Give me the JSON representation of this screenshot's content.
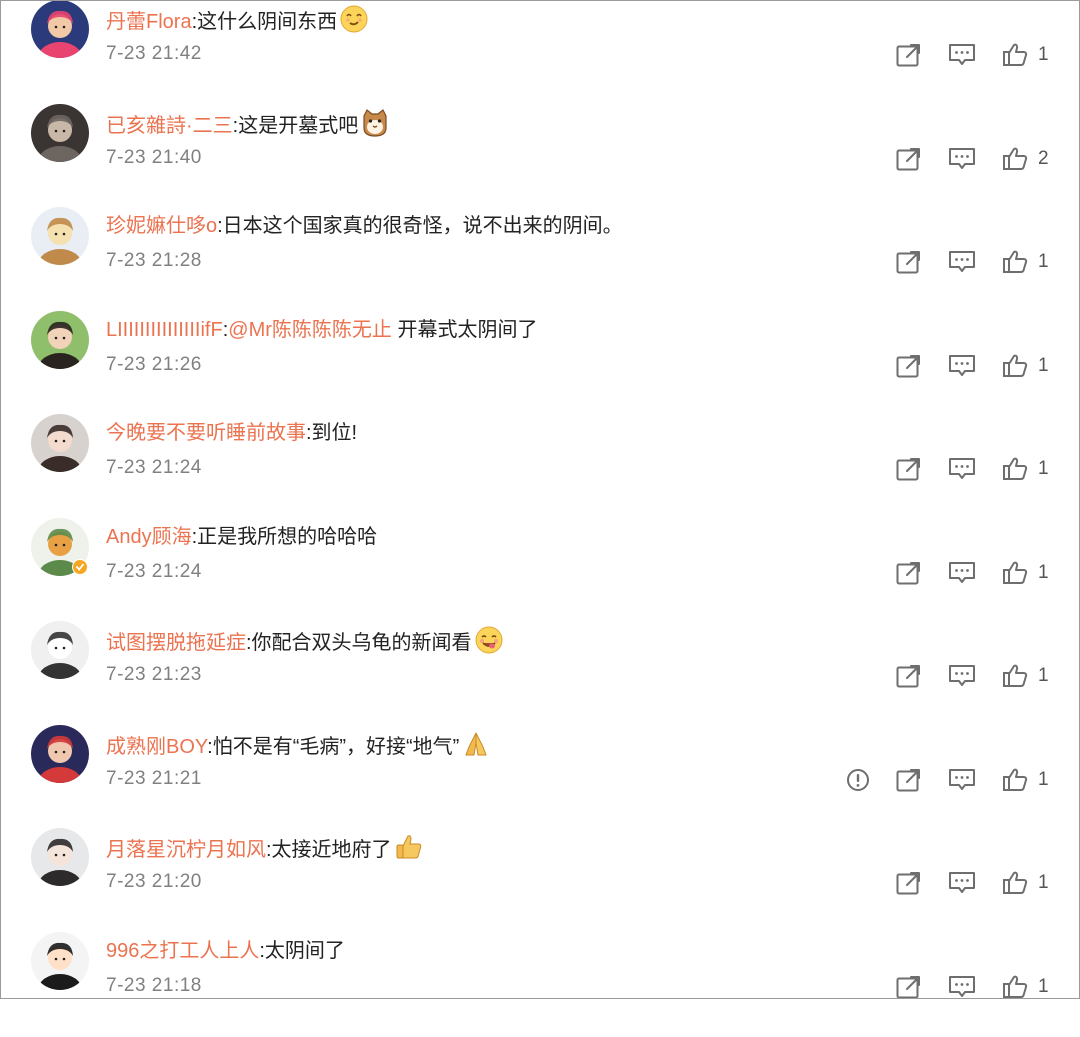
{
  "comments": [
    {
      "username": "丹蕾Flora",
      "text_parts": [
        {
          "t": ":这什么阴间东西",
          "mention": false
        }
      ],
      "emoji": "smirk-emoji-icon",
      "time": "7-23 21:42",
      "likes": "1",
      "report": false,
      "verified": false,
      "avatar": {
        "bg": "#2b3a7a",
        "fg": "#f2c9a6",
        "accent": "#e8446f"
      }
    },
    {
      "username": "已亥雜詩·二三",
      "text_parts": [
        {
          "t": ":这是开墓式吧",
          "mention": false
        }
      ],
      "emoji": "cat-emoji-icon",
      "time": "7-23 21:40",
      "likes": "2",
      "report": false,
      "verified": false,
      "avatar": {
        "bg": "#3a3432",
        "fg": "#c9b8a8",
        "accent": "#6d6560"
      }
    },
    {
      "username": "珍妮嫲仕哆o",
      "text_parts": [
        {
          "t": ":日本这个国家真的很奇怪，说不出来的阴间。",
          "mention": false
        }
      ],
      "emoji": "",
      "time": "7-23 21:28",
      "likes": "1",
      "report": false,
      "verified": false,
      "avatar": {
        "bg": "#e9eef5",
        "fg": "#f5e0b0",
        "accent": "#c08a4a"
      }
    },
    {
      "username": "LIIIIIIIIIIIIIIIifF",
      "text_parts": [
        {
          "t": ":",
          "mention": false
        },
        {
          "t": "@Mr陈陈陈陈无止",
          "mention": true
        },
        {
          "t": " 开幕式太阴间了",
          "mention": false
        }
      ],
      "emoji": "",
      "time": "7-23 21:26",
      "likes": "1",
      "report": false,
      "verified": false,
      "avatar": {
        "bg": "#8fbf6b",
        "fg": "#f2d2b8",
        "accent": "#2a2420"
      }
    },
    {
      "username": "今晚要不要听睡前故事",
      "text_parts": [
        {
          "t": ":到位!",
          "mention": false
        }
      ],
      "emoji": "",
      "time": "7-23 21:24",
      "likes": "1",
      "report": false,
      "verified": false,
      "avatar": {
        "bg": "#d8d2cf",
        "fg": "#f3dccd",
        "accent": "#3a2c28"
      }
    },
    {
      "username": "Andy顾海",
      "text_parts": [
        {
          "t": ":正是我所想的哈哈哈",
          "mention": false
        }
      ],
      "emoji": "",
      "time": "7-23 21:24",
      "likes": "1",
      "report": false,
      "verified": true,
      "avatar": {
        "bg": "#eef2ea",
        "fg": "#e7a144",
        "accent": "#5c8a4a"
      }
    },
    {
      "username": "试图摆脱拖延症",
      "text_parts": [
        {
          "t": ":你配合双头乌龟的新闻看",
          "mention": false
        }
      ],
      "emoji": "yummy-emoji-icon",
      "time": "7-23 21:23",
      "likes": "1",
      "report": false,
      "verified": false,
      "avatar": {
        "bg": "#f0f0f0",
        "fg": "#ffffff",
        "accent": "#333333"
      }
    },
    {
      "username": "成熟刚BOY",
      "text_parts": [
        {
          "t": ":怕不是有“毛病”，好接“地气”",
          "mention": false
        }
      ],
      "emoji": "pray-emoji-icon",
      "time": "7-23 21:21",
      "likes": "1",
      "report": true,
      "verified": false,
      "avatar": {
        "bg": "#2a2a5a",
        "fg": "#f0c8b0",
        "accent": "#d43a3a"
      }
    },
    {
      "username": "月落星沉柠月如风",
      "text_parts": [
        {
          "t": ":太接近地府了",
          "mention": false
        }
      ],
      "emoji": "thumbs-up-emoji-icon",
      "time": "7-23 21:20",
      "likes": "1",
      "report": false,
      "verified": false,
      "avatar": {
        "bg": "#e6e8ea",
        "fg": "#f4e4da",
        "accent": "#2c2a2a"
      }
    },
    {
      "username": "996之打工人上人",
      "text_parts": [
        {
          "t": ":太阴间了",
          "mention": false
        }
      ],
      "emoji": "",
      "time": "7-23 21:18",
      "likes": "1",
      "report": false,
      "verified": false,
      "avatar": {
        "bg": "#f4f4f4",
        "fg": "#ffe0c8",
        "accent": "#1b1b1b"
      }
    }
  ],
  "icons": {
    "forward": "forward-icon",
    "comment": "comment-icon",
    "like": "thumbs-up-icon",
    "report": "report-icon"
  },
  "colors": {
    "username": "#eb7350",
    "text": "#222222",
    "time": "#808080",
    "icon": "#6e6e6e"
  }
}
